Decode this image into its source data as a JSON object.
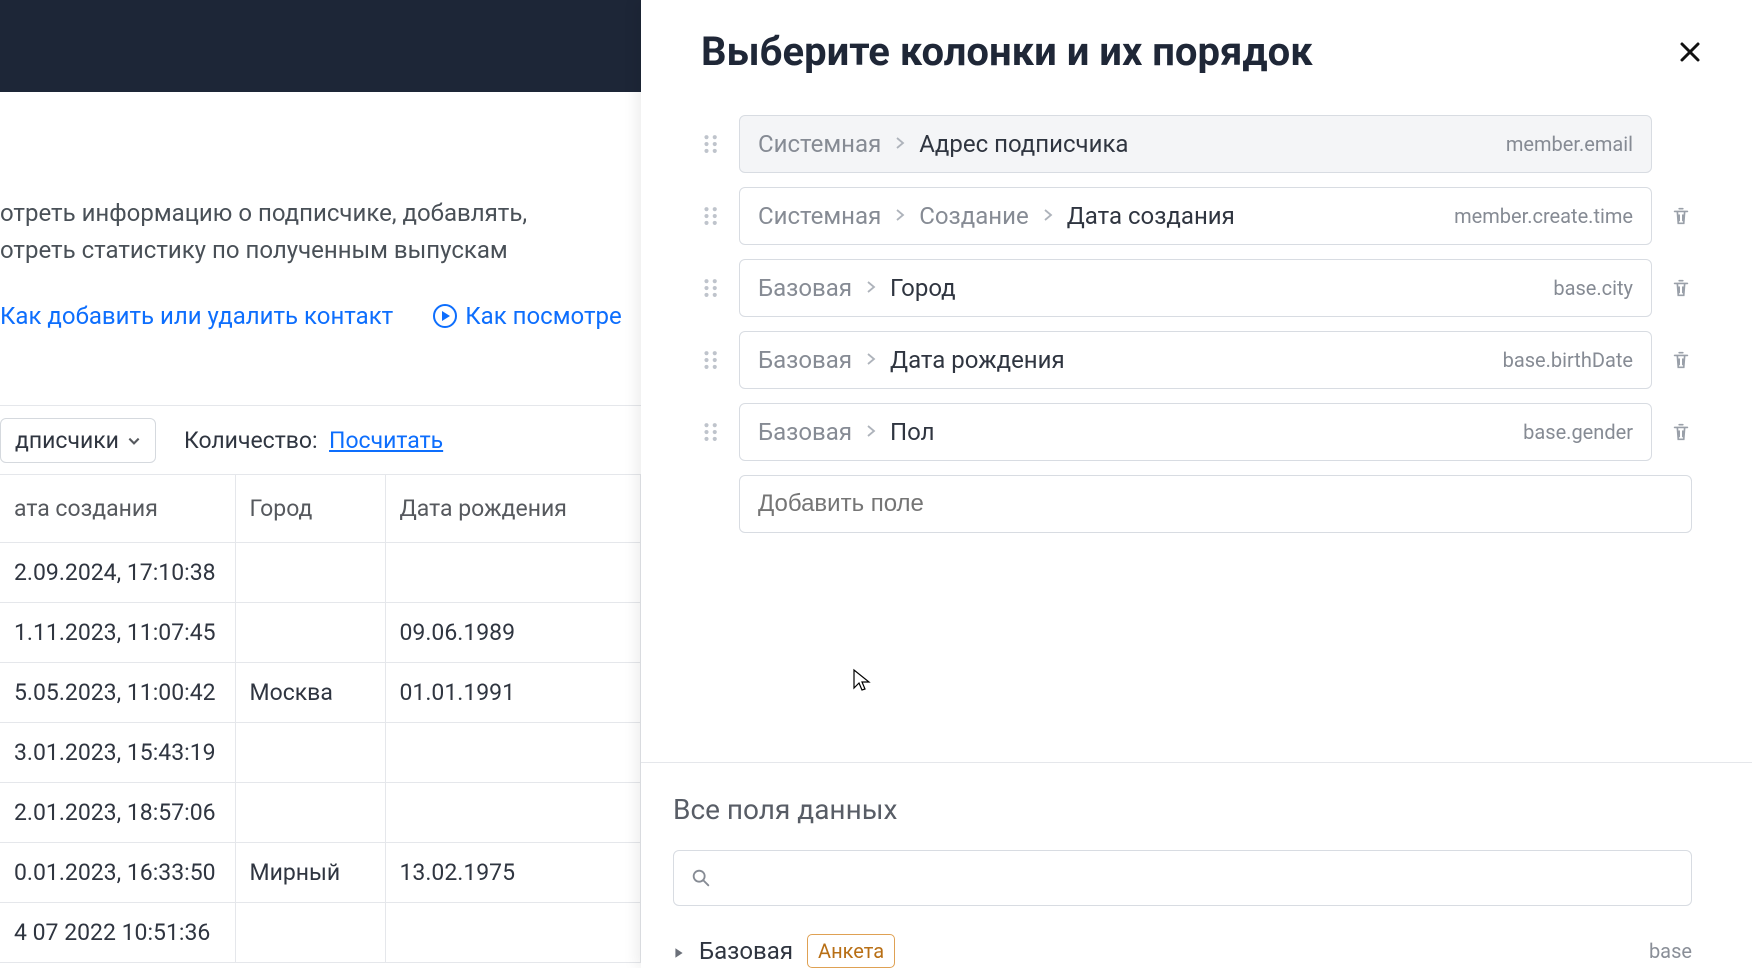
{
  "background": {
    "info_text_1": "отреть информацию о подписчике, добавлять,",
    "info_text_2": "отреть статистику по полученным выпускам",
    "link_add_remove": "Как добавить или удалить контакт",
    "link_how_view": "Как посмотре",
    "dropdown_label": "дписчики",
    "count_label": "Количество:",
    "count_action": "Посчитать",
    "headers": {
      "created": "ата создания",
      "city": "Город",
      "birth": "Дата рождения"
    },
    "rows": [
      {
        "created": "2.09.2024, 17:10:38",
        "city": "",
        "birth": ""
      },
      {
        "created": "1.11.2023, 11:07:45",
        "city": "",
        "birth": "09.06.1989"
      },
      {
        "created": "5.05.2023, 11:00:42",
        "city": "Москва",
        "birth": "01.01.1991"
      },
      {
        "created": "3.01.2023, 15:43:19",
        "city": "",
        "birth": ""
      },
      {
        "created": "2.01.2023, 18:57:06",
        "city": "",
        "birth": ""
      },
      {
        "created": "0.01.2023, 16:33:50",
        "city": "Мирный",
        "birth": "13.02.1975"
      },
      {
        "created": "4 07 2022  10:51:36",
        "city": "",
        "birth": ""
      }
    ]
  },
  "panel": {
    "title": "Выберите колонки и их порядок",
    "columns": [
      {
        "segments": [
          "Системная",
          "Адрес подписчика"
        ],
        "api": "member.email",
        "locked": true
      },
      {
        "segments": [
          "Системная",
          "Создание",
          "Дата создания"
        ],
        "api": "member.create.time",
        "locked": false
      },
      {
        "segments": [
          "Базовая",
          "Город"
        ],
        "api": "base.city",
        "locked": false
      },
      {
        "segments": [
          "Базовая",
          "Дата рождения"
        ],
        "api": "base.birthDate",
        "locked": false
      },
      {
        "segments": [
          "Базовая",
          "Пол"
        ],
        "api": "base.gender",
        "locked": false
      }
    ],
    "add_field_placeholder": "Добавить поле",
    "all_fields_title": "Все поля данных",
    "tree": {
      "root": "Базовая",
      "tag": "Анкета",
      "api": "base"
    }
  }
}
